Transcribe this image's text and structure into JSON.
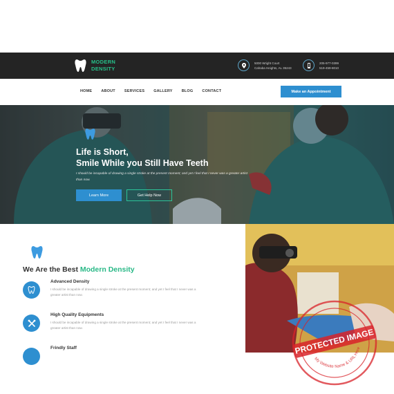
{
  "brand": {
    "name_line1": "MODERN",
    "name_line2": "DENSITY"
  },
  "contact": {
    "address_line1": "5000 Wright Court",
    "address_line2": "Cahaba Heights, AL 35243",
    "phone_line1": "205-977-0399",
    "phone_line2": "519-459-8010",
    "address_icon": "map-pin-icon",
    "phone_icon": "phone-icon"
  },
  "nav": {
    "items": [
      "HOME",
      "ABOUT",
      "SERVICES",
      "GALLERY",
      "BLOG",
      "CONTACT"
    ],
    "cta": "Make an Appointment"
  },
  "hero": {
    "title_line1": "Life is Short,",
    "title_line2": "Smile While you Still Have Teeth",
    "text": "I should be incapable of drawing a single stroke at the present moment; and yet I feel that I never was a greater artist than now.",
    "primary_button": "Learn More",
    "secondary_button": "Get Help Now"
  },
  "about": {
    "title_prefix": "We Are the Best ",
    "title_accent": "Modern Density",
    "features": [
      {
        "title": "Advanced Density",
        "text": "I should be incapable of drawing a single stroke at the present moment; and yet I feel that I never was a greater artist than now.",
        "icon": "tooth-icon"
      },
      {
        "title": "High Quality Equipments",
        "text": "I should be incapable of drawing a single stroke at the present moment; and yet I feel that I never was a greater artist than now.",
        "icon": "dental-tools-icon"
      },
      {
        "title": "Frindly Staff",
        "text": "",
        "icon": "staff-icon"
      }
    ]
  },
  "watermark": {
    "line1": "PROTECTED IMAGE",
    "line2": "My Website Name & URL Here"
  },
  "colors": {
    "primary": "#2e8fd0",
    "accent": "#28b886",
    "topbar": "#242424",
    "stamp": "#d8232a"
  }
}
